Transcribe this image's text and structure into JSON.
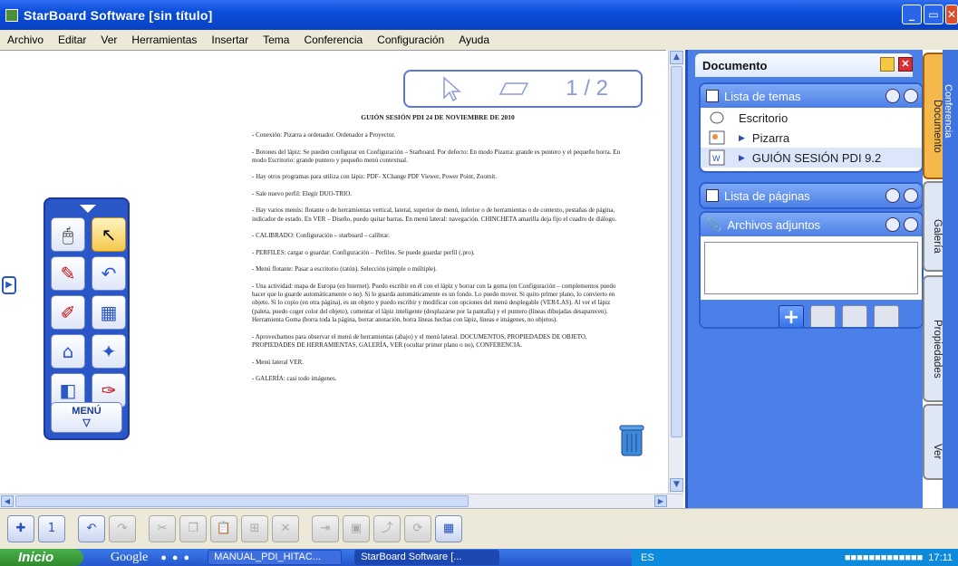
{
  "window": {
    "title": "StarBoard Software [sin título]"
  },
  "menu": [
    "Archivo",
    "Editar",
    "Ver",
    "Herramientas",
    "Insertar",
    "Tema",
    "Conferencia",
    "Configuración",
    "Ayuda"
  ],
  "page_indicator": "1 / 2",
  "document": {
    "title": "GUIÓN SESIÓN PDI 24 DE NOVIEMBRE DE 2010",
    "paragraphs": [
      "- Conexión: Pizarra a ordenador. Ordenador a Proyector.",
      "- Botones del lápiz: Se pueden configurar en Configuración – Starboard. Por defecto: En modo Pizarra: grande es puntero y el pequeño borra. En modo Escritorio: grande puntero y pequeño menú contextual.",
      "- Hay otros programas para utiliza con lápiz: PDF- XChange PDF Viewer, Power Point, Zoomit.",
      "- Sale nuevo perfil: Elegir DUO-TRIO.",
      "- Hay varios menús: flotante o de herramientas vertical, lateral, superior de menú, inferior o de herramientas o de contexto, pestañas de página, indicador de estado. En VER – Diseño, puedo quitar barras. En menú lateral: navegación. CHINCHETA amarilla deja fijo el cuadro de diálogo.",
      "- CALIBRADO: Configuración – starboard – calibrar.",
      "- PERFILES: cargar o guardar: Configuración – Perfiles. Se puede guardar perfil (.pro).",
      "- Menú flotante: Pasar a escritorio (ratón). Selección (simple o múltiple).",
      "- Una actividad: mapa de Europa (en Internet). Puedo escribir en él con el lápiz y borrar con la goma (en Configuración – complementos puedo hacer que lo guarde automáticamente o no). Si lo guarda automáticamente es un fondo. Lo puedo mover. Si quito primer plano, lo convierto en objeto. Si lo copio (en otra página), es un objeto y puedo escribir y modificar con opciones del menú desplegable (VER/LAS). Al ver el lápiz (paleta, puedo coger color del objeto), comentar el lápiz inteligente (desplazarse por la pantalla) y el puntero (líneas dibujadas desaparecen). Herramienta Goma (borra toda la página, borrar anotación, borra líneas hechas con lápiz, líneas e imágenes, no objetos).",
      "- Aprovechamos para observar el menú de herramientas (abajo) y el menú lateral. DOCUMENTOS, PROPIEDADES DE OBJETO, PROPIEDADES DE HERRAMIENTAS, GALERÍA, VER (ocultar primer plano o no), CONFERENCIA.",
      "- Menú lateral VER.",
      "- GALERÍA: casi todo imágenes."
    ]
  },
  "toolbox": {
    "menu_label": "MENÚ"
  },
  "panel": {
    "header": "Documento",
    "topics": {
      "title": "Lista de temas",
      "items": [
        "Escritorio",
        "Pizarra",
        "GUIÓN SESIÓN PDI 9.2"
      ]
    },
    "pages": {
      "title": "Lista de páginas"
    },
    "attachments": {
      "title": "Archivos adjuntos"
    }
  },
  "side_tabs": [
    "Documento",
    "Galería",
    "Propiedades",
    "Ver"
  ],
  "far_tab": "Conferencia",
  "taskbar": {
    "start": "Inicio",
    "google": "Google",
    "tasks": [
      "MANUAL_PDI_HITAC...",
      "StarBoard Software [..."
    ],
    "lang": "ES",
    "clock": "17:11"
  }
}
